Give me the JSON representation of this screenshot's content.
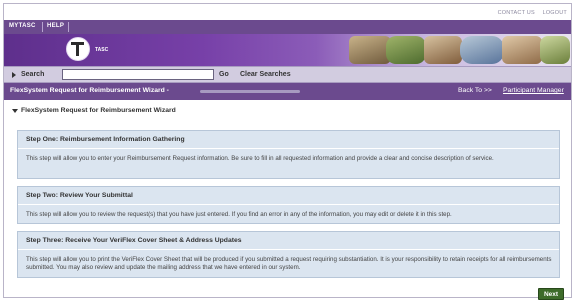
{
  "header": {
    "top_links": [
      "CONTACT US",
      "LOGOUT"
    ],
    "nav_tabs": [
      "MYTASC",
      "HELP"
    ],
    "logo_text": "TASC"
  },
  "search": {
    "label": "Search",
    "value": "",
    "go_label": "Go",
    "clear_label": "Clear Searches"
  },
  "titlebar": {
    "title": "FlexSystem Request for Reimbursement Wizard -",
    "back_label": "Back To >>",
    "participant_link": "Participant Manager"
  },
  "section": {
    "title": "FlexSystem Request for Reimbursement Wizard"
  },
  "steps": [
    {
      "title": "Step One: Reimbursement Information Gathering",
      "description": "This step will allow you to enter your Reimbursement Request information. Be sure to fill in all requested information and provide a clear and concise description of service."
    },
    {
      "title": "Step Two: Review Your Submittal",
      "description": "This step will allow you to review the request(s) that you have just entered. If you find an error in any of the information, you may edit or delete it in this step."
    },
    {
      "title": "Step Three: Receive Your VeriFlex Cover Sheet & Address Updates",
      "description": "This step will allow you to print the VeriFlex Cover Sheet that will be produced if you submitted a request requiring substantiation. It is your responsibility to retain receipts for all reimbursements submitted. You may also review and update the mailing address that we have entered in our system."
    }
  ],
  "actions": {
    "next_label": "Next"
  },
  "colors": {
    "brand_purple": "#6b4a8e",
    "step_bg": "#dbe5f0",
    "next_green": "#3d6b2a"
  }
}
